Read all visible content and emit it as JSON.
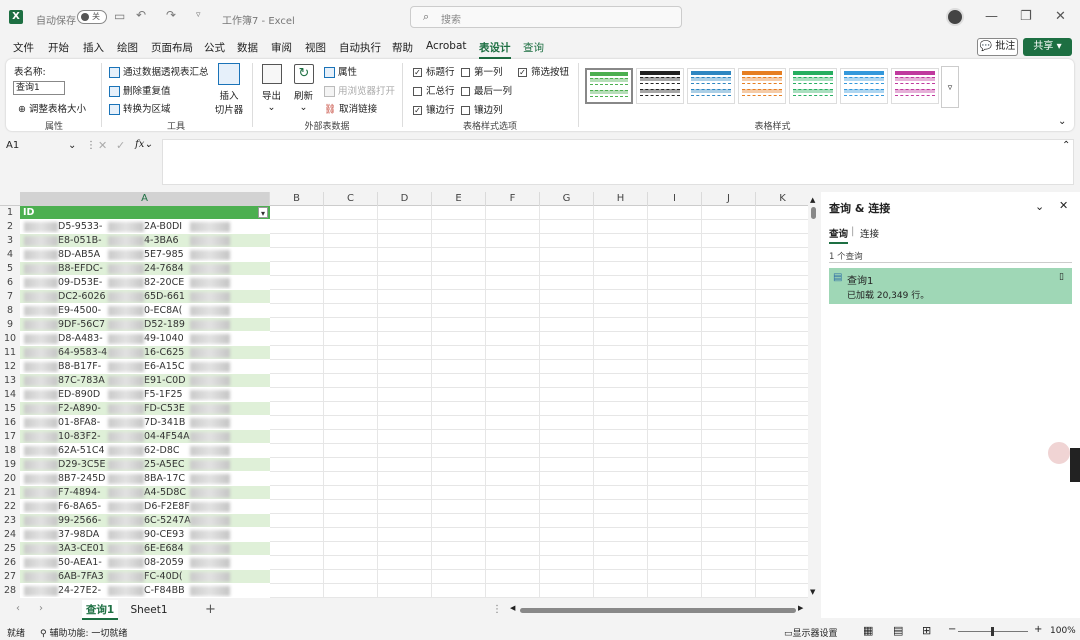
{
  "titlebar": {
    "autosave_label": "自动保存",
    "autosave_state": "关",
    "document_title": "工作簿7  -  Excel",
    "search_placeholder": "搜索"
  },
  "menu": [
    "文件",
    "开始",
    "插入",
    "绘图",
    "页面布局",
    "公式",
    "数据",
    "审阅",
    "视图",
    "自动执行",
    "帮助",
    "Acrobat",
    "表设计",
    "查询"
  ],
  "menu_active": "表设计",
  "comment_label": "批注",
  "share_label": "共享",
  "ribbon": {
    "table_name_label": "表名称:",
    "table_name_value": "查询1",
    "resize_table": "调整表格大小",
    "group_properties": "属性",
    "pivot_summary": "通过数据透视表汇总",
    "remove_duplicates": "删除重复值",
    "convert_to_range": "转换为区域",
    "insert_slicer_1": "插入",
    "insert_slicer_2": "切片器",
    "group_tools": "工具",
    "export": "导出",
    "refresh": "刷新",
    "properties": "属性",
    "open_in_browser": "用浏览器打开",
    "unlink": "取消链接",
    "group_external": "外部表数据",
    "opt_header_row": "标题行",
    "opt_total_row": "汇总行",
    "opt_banded_rows": "镶边行",
    "opt_first_col": "第一列",
    "opt_last_col": "最后一列",
    "opt_banded_cols": "镶边列",
    "opt_filter_btn": "筛选按钮",
    "group_style_options": "表格样式选项",
    "group_table_styles": "表格样式",
    "style_colors": [
      "#4caf50",
      "#222222",
      "#2e86c1",
      "#e67e22",
      "#27ae60",
      "#3498db",
      "#c0399e"
    ]
  },
  "formula_bar": {
    "name_box": "A1",
    "fx": "fx"
  },
  "columns": [
    "A",
    "B",
    "C",
    "D",
    "E",
    "F",
    "G",
    "H",
    "I",
    "J",
    "K"
  ],
  "header_cell": "ID",
  "rows": [
    {
      "n": "1",
      "a": "ID",
      "b": "",
      "c": ""
    },
    {
      "n": "2",
      "a": "D5-9533-",
      "b": "2A-B0DI",
      "c": ""
    },
    {
      "n": "3",
      "a": "E8-051B-",
      "b": "4-3BA6",
      "c": ""
    },
    {
      "n": "4",
      "a": "8D-AB5A",
      "b": "5E7-985",
      "c": ""
    },
    {
      "n": "5",
      "a": "B8-EFDC-",
      "b": "24-7684",
      "c": ""
    },
    {
      "n": "6",
      "a": "09-D53E-",
      "b": "82-20CE",
      "c": ""
    },
    {
      "n": "7",
      "a": "DC2-6026",
      "b": "65D-661",
      "c": ""
    },
    {
      "n": "8",
      "a": "E9-4500-",
      "b": "0-EC8A(",
      "c": ""
    },
    {
      "n": "9",
      "a": "9DF-56C7",
      "b": "D52-189",
      "c": ""
    },
    {
      "n": "10",
      "a": "D8-A483-",
      "b": "49-1040",
      "c": ""
    },
    {
      "n": "11",
      "a": "64-9583-4",
      "b": "16-C625",
      "c": ""
    },
    {
      "n": "12",
      "a": "B8-B17F-",
      "b": "E6-A15C",
      "c": ""
    },
    {
      "n": "13",
      "a": "87C-783A",
      "b": "E91-C0D",
      "c": ""
    },
    {
      "n": "14",
      "a": "ED-890D",
      "b": "F5-1F25",
      "c": ""
    },
    {
      "n": "15",
      "a": "F2-A890-",
      "b": "FD-C53E",
      "c": ""
    },
    {
      "n": "16",
      "a": "01-8FA8-",
      "b": "7D-341B",
      "c": ""
    },
    {
      "n": "17",
      "a": "10-83F2-",
      "b": "04-4F54A",
      "c": ""
    },
    {
      "n": "18",
      "a": "62A-51C4",
      "b": "62-D8C",
      "c": ""
    },
    {
      "n": "19",
      "a": "D29-3C5E",
      "b": "25-A5EC",
      "c": ""
    },
    {
      "n": "20",
      "a": "8B7-245D",
      "b": "8BA-17C",
      "c": ""
    },
    {
      "n": "21",
      "a": "F7-4894-",
      "b": "A4-5D8C",
      "c": ""
    },
    {
      "n": "22",
      "a": "F6-8A65-",
      "b": "D6-F2E8F",
      "c": ""
    },
    {
      "n": "23",
      "a": "99-2566-",
      "b": "6C-5247A",
      "c": ""
    },
    {
      "n": "24",
      "a": "37-98DA",
      "b": "90-CE93",
      "c": ""
    },
    {
      "n": "25",
      "a": "3A3-CE01",
      "b": "6E-E684",
      "c": ""
    },
    {
      "n": "26",
      "a": "50-AEA1-",
      "b": "08-2059",
      "c": ""
    },
    {
      "n": "27",
      "a": "6AB-7FA3",
      "b": "FC-40D(",
      "c": ""
    },
    {
      "n": "28",
      "a": "24-27E2-",
      "b": "C-F84BB",
      "c": ""
    }
  ],
  "sheet_tabs": [
    "查询1",
    "Sheet1"
  ],
  "status": {
    "ready": "就绪",
    "accessibility": "辅助功能: 一切就绪",
    "display_settings": "显示器设置",
    "zoom": "100%"
  },
  "pane": {
    "title": "查询 & 连接",
    "tab_queries": "查询",
    "tab_connections": "连接",
    "count": "1 个查询",
    "query_name": "查询1",
    "query_status": "已加载 20,349 行。"
  }
}
